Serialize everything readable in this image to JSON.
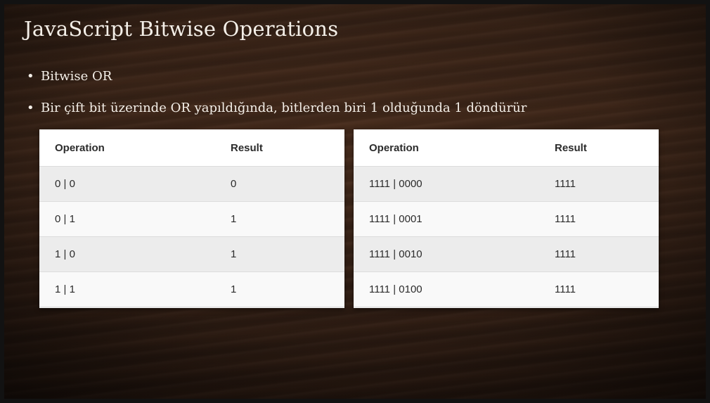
{
  "slide": {
    "title": "JavaScript Bitwise Operations",
    "bullets": [
      "Bitwise OR",
      "Bir çift bit üzerinde OR yapıldığında, bitlerden biri 1 olduğunda 1 döndürür"
    ],
    "bullet_symbol": "•"
  },
  "tables": [
    {
      "headers": [
        "Operation",
        "Result"
      ],
      "rows": [
        [
          "0 | 0",
          "0"
        ],
        [
          "0 | 1",
          "1"
        ],
        [
          "1 | 0",
          "1"
        ],
        [
          "1 | 1",
          "1"
        ]
      ]
    },
    {
      "headers": [
        "Operation",
        "Result"
      ],
      "rows": [
        [
          "1111 | 0000",
          "1111"
        ],
        [
          "1111 | 0001",
          "1111"
        ],
        [
          "1111 | 0010",
          "1111"
        ],
        [
          "1111 | 0100",
          "1111"
        ]
      ]
    }
  ]
}
